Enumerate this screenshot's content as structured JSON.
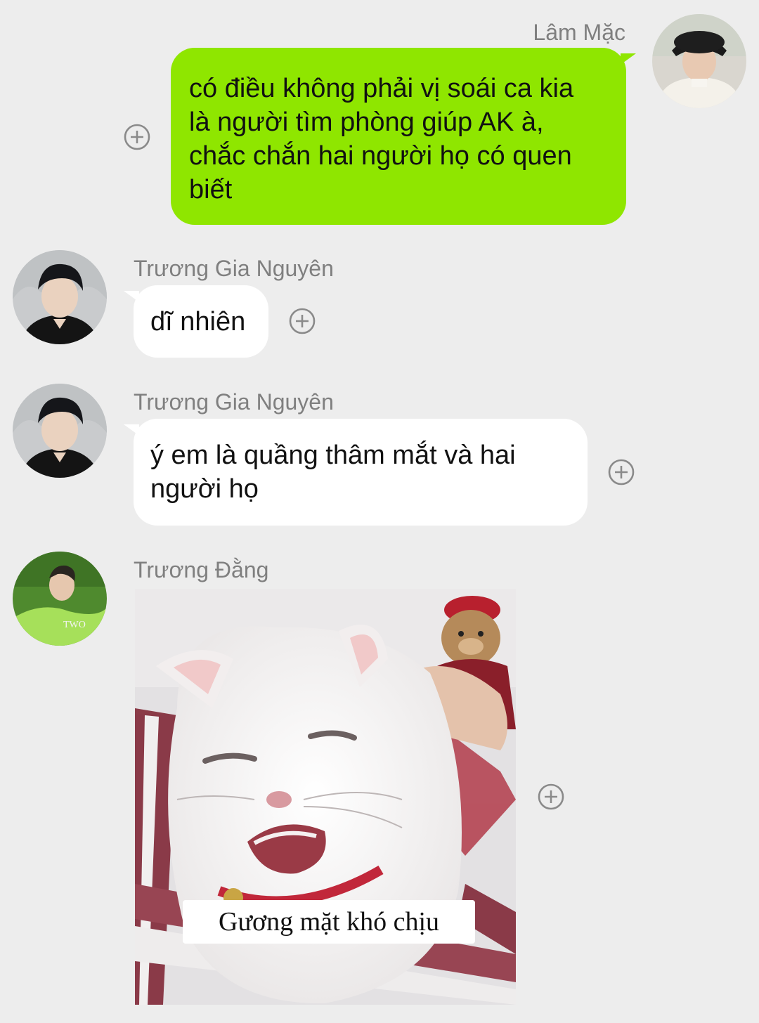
{
  "messages": [
    {
      "sender": "Lâm Mặc",
      "side": "right",
      "text": "có điều không phải vị soái ca kia\nlà người tìm phòng giúp AK à,\nchắc chắn hai người họ có quen\nbiết",
      "avatar": "user-avatar-lam-mac"
    },
    {
      "sender": "Trương Gia Nguyên",
      "side": "left",
      "text": "dĩ nhiên",
      "avatar": "user-avatar-truong-gia-nguyen"
    },
    {
      "sender": "Trương Gia Nguyên",
      "side": "left",
      "text": "ý em là quầng thâm mắt và hai\nngười họ",
      "avatar": "user-avatar-truong-gia-nguyen"
    },
    {
      "sender": "Trương Đằng",
      "side": "left",
      "sticker_caption": "Gương mặt khó chịu",
      "avatar": "user-avatar-truong-dang"
    }
  ],
  "icons": {
    "add": "plus-circle-icon"
  },
  "colors": {
    "background": "#ededed",
    "outgoing_bubble": "#8fe600",
    "incoming_bubble": "#ffffff",
    "sender_name": "#7f7f7f"
  }
}
